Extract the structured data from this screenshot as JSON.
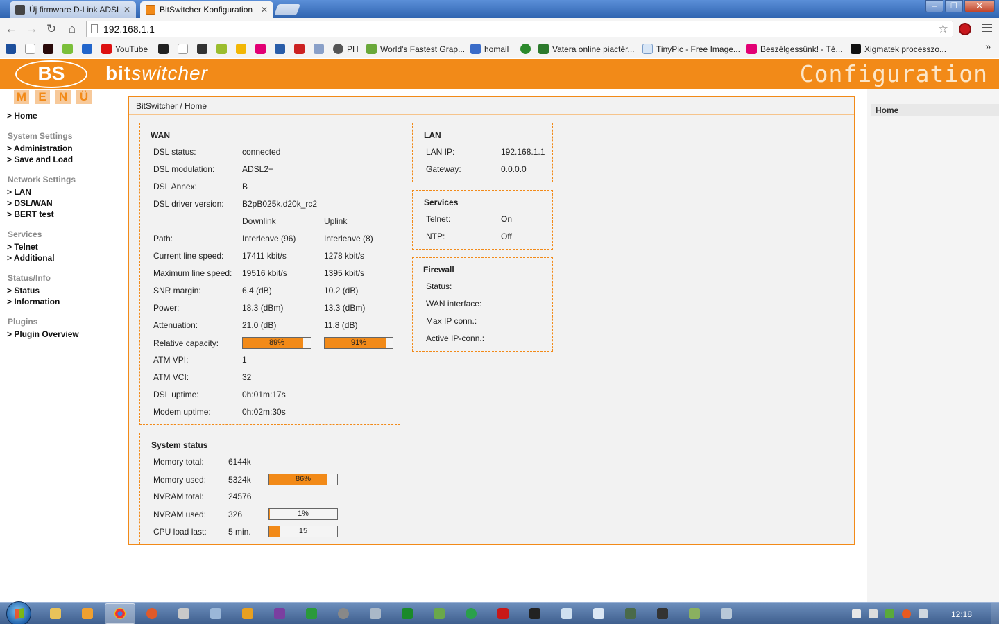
{
  "browser": {
    "tabs": [
      {
        "title": "Új firmware D-Link ADSL r",
        "active": false
      },
      {
        "title": "BitSwitcher Konfiguration",
        "active": true
      }
    ],
    "url": "192.168.1.1",
    "bookmarks": [
      "YouTube",
      "PH",
      "World's Fastest Grap...",
      "homail",
      "Vatera online piactér...",
      "TinyPic - Free Image...",
      "Beszélgessünk! - Té...",
      "Xigmatek processzo..."
    ],
    "more_symbol": "»"
  },
  "header": {
    "logo_text": "BS",
    "brand_bold": "bit",
    "brand_italic": "switcher",
    "config_title": "Configuration",
    "accent_color": "#f28a18"
  },
  "menu": {
    "title_letters": [
      "M",
      "E",
      "N",
      "Ü"
    ],
    "home": "> Home",
    "system_settings": {
      "label": "System Settings",
      "items": [
        "> Administration",
        "> Save and Load"
      ]
    },
    "network_settings": {
      "label": "Network Settings",
      "items": [
        "> LAN",
        "> DSL/WAN",
        "> BERT test"
      ]
    },
    "services": {
      "label": "Services",
      "items": [
        "> Telnet",
        "> Additional"
      ]
    },
    "status_info": {
      "label": "Status/Info",
      "items": [
        "> Status",
        "> Information"
      ]
    },
    "plugins": {
      "label": "Plugins",
      "items": [
        "> Plugin Overview"
      ]
    }
  },
  "breadcrumb": "BitSwitcher / Home",
  "wan": {
    "title": "WAN",
    "dsl_status_label": "DSL status:",
    "dsl_status": "connected",
    "dsl_modulation_label": "DSL modulation:",
    "dsl_modulation": "ADSL2+",
    "dsl_annex_label": "DSL Annex:",
    "dsl_annex": "B",
    "dsl_driver_label": "DSL driver version:",
    "dsl_driver": "B2pB025k.d20k_rc2",
    "col_downlink": "Downlink",
    "col_uplink": "Uplink",
    "rows": [
      {
        "label": "Path:",
        "down": "Interleave (96)",
        "up": "Interleave (8)"
      },
      {
        "label": "Current line speed:",
        "down": "17411 kbit/s",
        "up": "1278 kbit/s"
      },
      {
        "label": "Maximum line speed:",
        "down": "19516 kbit/s",
        "up": "1395 kbit/s"
      },
      {
        "label": "SNR margin:",
        "down": "6.4 (dB)",
        "up": "10.2 (dB)"
      },
      {
        "label": "Power:",
        "down": "18.3 (dBm)",
        "up": "13.3 (dBm)"
      },
      {
        "label": "Attenuation:",
        "down": "21.0 (dB)",
        "up": "11.8 (dB)"
      }
    ],
    "relative_capacity_label": "Relative capacity:",
    "relative_capacity_down": "89%",
    "relative_capacity_down_value": 89,
    "relative_capacity_up": "91%",
    "relative_capacity_up_value": 91,
    "atm_vpi_label": "ATM VPI:",
    "atm_vpi": "1",
    "atm_vci_label": "ATM VCI:",
    "atm_vci": "32",
    "dsl_uptime_label": "DSL uptime:",
    "dsl_uptime": "0h:01m:17s",
    "modem_uptime_label": "Modem uptime:",
    "modem_uptime": "0h:02m:30s"
  },
  "system_status": {
    "title": "System status",
    "memory_total_label": "Memory total:",
    "memory_total": "6144k",
    "memory_used_label": "Memory used:",
    "memory_used": "5324k",
    "memory_used_pct": "86%",
    "memory_used_value": 86,
    "nvram_total_label": "NVRAM total:",
    "nvram_total": "24576",
    "nvram_used_label": "NVRAM used:",
    "nvram_used": "326",
    "nvram_used_pct": "1%",
    "nvram_used_value": 1,
    "cpu_load_label": "CPU load last:",
    "cpu_load_period": "5 min.",
    "cpu_load": "15",
    "cpu_load_value": 15
  },
  "lan": {
    "title": "LAN",
    "lan_ip_label": "LAN IP:",
    "lan_ip": "192.168.1.1",
    "gateway_label": "Gateway:",
    "gateway": "0.0.0.0"
  },
  "services": {
    "title": "Services",
    "telnet_label": "Telnet:",
    "telnet": "On",
    "ntp_label": "NTP:",
    "ntp": "Off"
  },
  "firewall": {
    "title": "Firewall",
    "status_label": "Status:",
    "wan_interface_label": "WAN interface:",
    "max_ip_label": "Max IP conn.:",
    "active_ip_label": "Active IP-conn.:"
  },
  "right_column": {
    "home": "Home"
  },
  "taskbar": {
    "clock": "12:18"
  }
}
